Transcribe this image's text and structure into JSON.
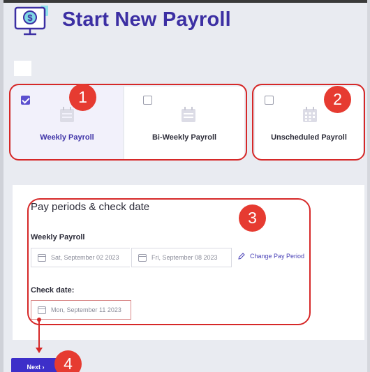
{
  "header": {
    "title": "Start New Payroll",
    "icon": "payroll-monitor-dollar-icon"
  },
  "payroll_types": [
    {
      "label": "Weekly Payroll",
      "checked": true,
      "icon": "calendar-icon"
    },
    {
      "label": "Bi-Weekly Payroll",
      "checked": false,
      "icon": "calendar-icon"
    },
    {
      "label": "Unscheduled Payroll",
      "checked": false,
      "icon": "calendar-grid-icon"
    }
  ],
  "pay_periods": {
    "title": "Pay periods & check date",
    "schedule_label": "Weekly Payroll",
    "start_date": "Sat, September 02 2023",
    "end_date": "Fri, September 08 2023",
    "change_link": "Change Pay Period",
    "check_date_label": "Check date:",
    "check_date": "Mon, September 11 2023"
  },
  "actions": {
    "next_label": "Next ›"
  },
  "annotations": {
    "badge_1": "1",
    "badge_2": "2",
    "badge_3": "3",
    "badge_4": "4"
  },
  "colors": {
    "accent": "#3d2fc9",
    "title": "#3c2fa3",
    "annotation": "#e63b31"
  }
}
